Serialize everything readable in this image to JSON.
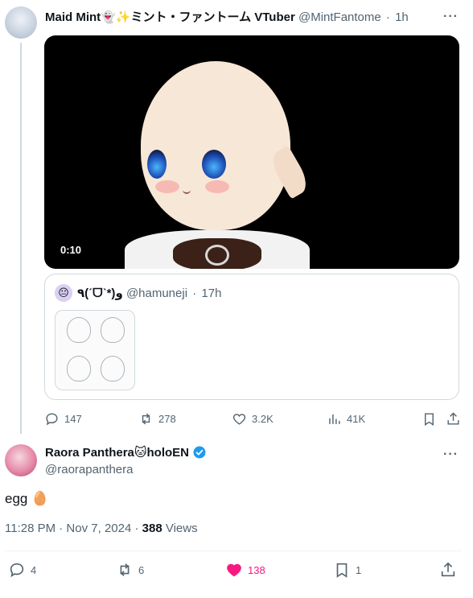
{
  "parent_tweet": {
    "author_name": "Maid Mint",
    "author_emoji": "👻✨",
    "author_suffix": "ミント・ファントーム VTuber",
    "handle": "@MintFantome",
    "time": "1h",
    "video_time": "0:10",
    "quote": {
      "author_name": "٩(ˊᗜˋ*)و",
      "handle": "@hamuneji",
      "time": "17h"
    },
    "stats": {
      "replies": "147",
      "reposts": "278",
      "likes": "3.2K",
      "views": "41K"
    }
  },
  "reply_tweet": {
    "author_name": "Raora Panthera",
    "author_emoji": "🐱",
    "author_suffix": "holoEN",
    "handle": "@raorapanthera",
    "text": "egg 🥚",
    "timestamp": "11:28 PM · Nov 7, 2024 · ",
    "views_count": "388",
    "views_label": " Views",
    "stats": {
      "replies": "4",
      "reposts": "6",
      "likes": "138",
      "bookmarks": "1"
    }
  },
  "colors": {
    "like_active": "#f91880",
    "verified": "#1d9bf0",
    "secondary_text": "#536471"
  }
}
